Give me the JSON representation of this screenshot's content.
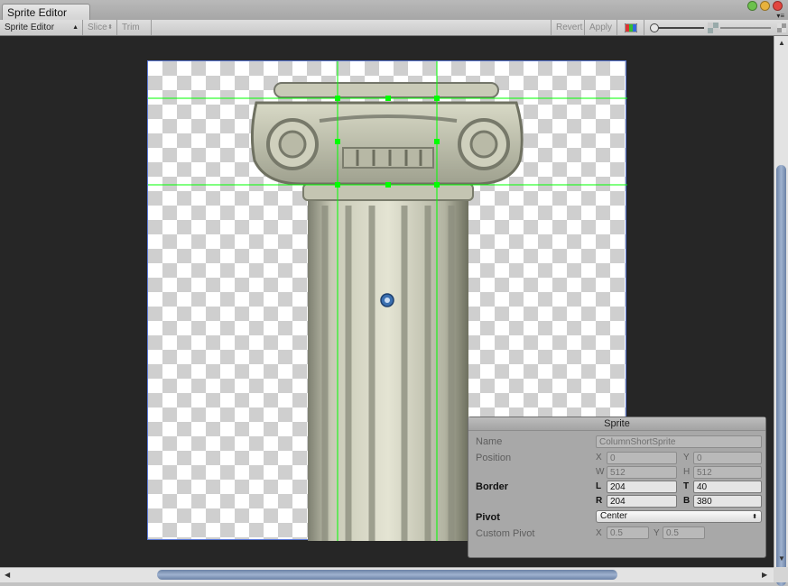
{
  "window": {
    "tab_title": "Sprite Editor"
  },
  "toolbar": {
    "mode_dropdown": "Sprite Editor",
    "slice_label": "Slice",
    "trim_label": "Trim",
    "revert_label": "Revert",
    "apply_label": "Apply"
  },
  "inspector": {
    "title": "Sprite",
    "name_label": "Name",
    "name_value": "ColumnShortSprite",
    "position_label": "Position",
    "x_label": "X",
    "x_value": "0",
    "y_label": "Y",
    "y_value": "0",
    "w_label": "W",
    "w_value": "512",
    "h_label": "H",
    "h_value": "512",
    "border_label": "Border",
    "l_label": "L",
    "l_value": "204",
    "t_label": "T",
    "t_value": "40",
    "r_label": "R",
    "r_value": "204",
    "b_label": "B",
    "b_value": "380",
    "pivot_label": "Pivot",
    "pivot_value": "Center",
    "custom_pivot_label": "Custom Pivot",
    "cp_x_label": "X",
    "cp_x_value": "0.5",
    "cp_y_label": "Y",
    "cp_y_value": "0.5"
  },
  "colors": {
    "canvas_bg": "#262626",
    "slice_guides": "#00ff00",
    "sprite_rect_outline": "#5b79d6",
    "pivot_handle": "#3a6fb0"
  },
  "icons": [
    "close-window-icon",
    "minimize-window-icon",
    "zoom-window-icon",
    "panel-menu-icon",
    "rgb-channel-toggle-icon",
    "alpha-toggle-icon",
    "mipmap-icon",
    "pivot-handle-icon"
  ]
}
